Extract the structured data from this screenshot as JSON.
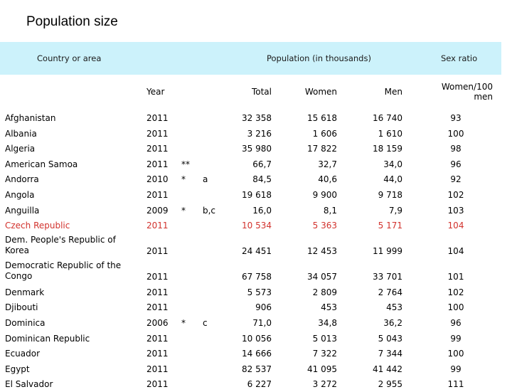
{
  "title": "Population size",
  "header": {
    "country": "Country or area",
    "population": "Population (in thousands)",
    "sex_ratio": "Sex ratio"
  },
  "subheader": {
    "year": "Year",
    "total": "Total",
    "women": "Women",
    "men": "Men",
    "ratio": "Women/100 men"
  },
  "rows": [
    {
      "country": "Afghanistan",
      "year": "2011",
      "mark": "",
      "note": "",
      "total": "32 358",
      "women": "15 618",
      "men": "16 740",
      "ratio": "93"
    },
    {
      "country": "Albania",
      "year": "2011",
      "mark": "",
      "note": "",
      "total": "3 216",
      "women": "1 606",
      "men": "1 610",
      "ratio": "100"
    },
    {
      "country": "Algeria",
      "year": "2011",
      "mark": "",
      "note": "",
      "total": "35 980",
      "women": "17 822",
      "men": "18 159",
      "ratio": "98"
    },
    {
      "country": "American Samoa",
      "year": "2011",
      "mark": "**",
      "note": "",
      "total": "66,7",
      "women": "32,7",
      "men": "34,0",
      "ratio": "96"
    },
    {
      "country": "Andorra",
      "year": "2010",
      "mark": "*",
      "note": "a",
      "total": "84,5",
      "women": "40,6",
      "men": "44,0",
      "ratio": "92"
    },
    {
      "country": "Angola",
      "year": "2011",
      "mark": "",
      "note": "",
      "total": "19 618",
      "women": "9 900",
      "men": "9 718",
      "ratio": "102"
    },
    {
      "country": "Anguilla",
      "year": "2009",
      "mark": "*",
      "note": "b,c",
      "total": "16,0",
      "women": "8,1",
      "men": "7,9",
      "ratio": "103"
    },
    {
      "country": "Czech Republic",
      "year": "2011",
      "mark": "",
      "note": "",
      "total": "10 534",
      "women": "5 363",
      "men": "5 171",
      "ratio": "104"
    },
    {
      "country": "Dem. People's Republic of Korea",
      "year": "2011",
      "mark": "",
      "note": "",
      "total": "24 451",
      "women": "12 453",
      "men": "11 999",
      "ratio": "104"
    },
    {
      "country": "Democratic Republic of the Congo",
      "year": "2011",
      "mark": "",
      "note": "",
      "total": "67 758",
      "women": "34 057",
      "men": "33 701",
      "ratio": "101"
    },
    {
      "country": "Denmark",
      "year": "2011",
      "mark": "",
      "note": "",
      "total": "5 573",
      "women": "2 809",
      "men": "2 764",
      "ratio": "102"
    },
    {
      "country": "Djibouti",
      "year": "2011",
      "mark": "",
      "note": "",
      "total": "906",
      "women": "453",
      "men": "453",
      "ratio": "100"
    },
    {
      "country": "Dominica",
      "year": "2006",
      "mark": "*",
      "note": "c",
      "total": "71,0",
      "women": "34,8",
      "men": "36,2",
      "ratio": "96"
    },
    {
      "country": "Dominican Republic",
      "year": "2011",
      "mark": "",
      "note": "",
      "total": "10 056",
      "women": "5 013",
      "men": "5 043",
      "ratio": "99"
    },
    {
      "country": "Ecuador",
      "year": "2011",
      "mark": "",
      "note": "",
      "total": "14 666",
      "women": "7 322",
      "men": "7 344",
      "ratio": "100"
    },
    {
      "country": "Egypt",
      "year": "2011",
      "mark": "",
      "note": "",
      "total": "82 537",
      "women": "41 095",
      "men": "41 442",
      "ratio": "99"
    },
    {
      "country": "El Salvador",
      "year": "2011",
      "mark": "",
      "note": "",
      "total": "6 227",
      "women": "3 272",
      "men": "2 955",
      "ratio": "111"
    }
  ],
  "highlight_row": "Czech Republic",
  "colors": {
    "header_band": "#ccf2fb",
    "highlight_text": "#d2322d"
  }
}
